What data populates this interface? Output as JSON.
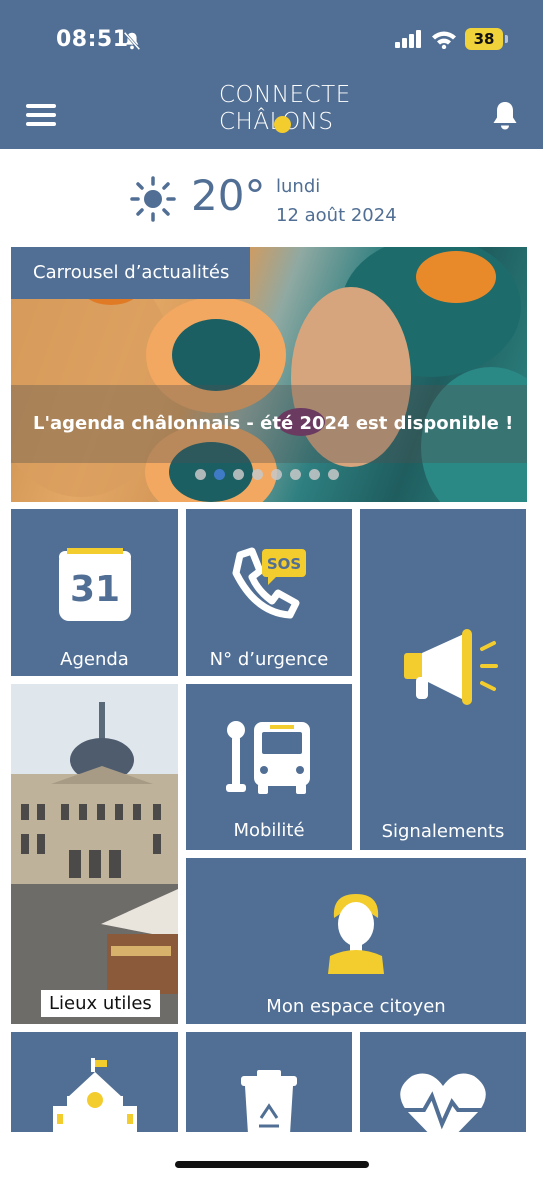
{
  "status_bar": {
    "time": "08:51",
    "battery": "38"
  },
  "header": {
    "logo_line1": "CONNECTE",
    "logo_line2": "CHÂLONS"
  },
  "weather": {
    "temperature": "20°",
    "day": "lundi",
    "date": "12 août 2024"
  },
  "carousel": {
    "label": "Carrousel d’actualités",
    "title": "L'agenda châlonnais - été 2024 est disponible !",
    "slides": 8,
    "active_slide": 2
  },
  "tiles": {
    "agenda": {
      "label": "Agenda",
      "day": "31"
    },
    "urgence": {
      "label": "N° d’urgence",
      "badge": "SOS"
    },
    "signalements": {
      "label": "Signalements"
    },
    "lieux": {
      "label": "Lieux utiles"
    },
    "mobilite": {
      "label": "Mobilité"
    },
    "citoyen": {
      "label": "Mon espace citoyen"
    }
  },
  "colors": {
    "primary": "#516f94",
    "accent": "#f3cc2e"
  }
}
